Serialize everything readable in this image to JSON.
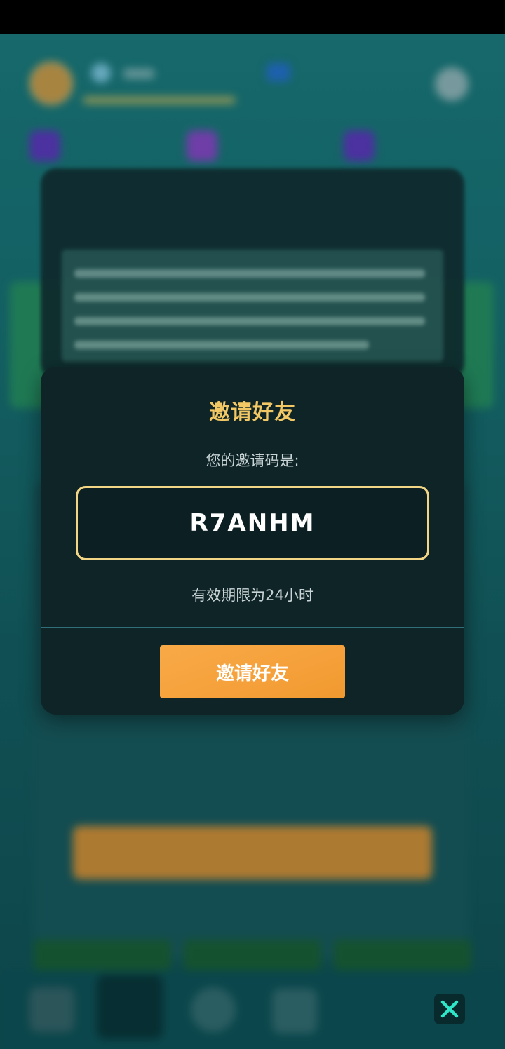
{
  "dialog": {
    "title": "邀请好友",
    "code_label": "您的邀请码是:",
    "invite_code": "R7ANHM",
    "validity_text": "有效期限为24小时",
    "invite_button_label": "邀请好友"
  },
  "colors": {
    "title_gold": "#f2c865",
    "code_border": "#f2d685",
    "button_orange": "#f5a03a",
    "modal_bg": "#0f2427",
    "close_icon": "#2ee6c8"
  },
  "icons": {
    "close": "close-icon"
  }
}
